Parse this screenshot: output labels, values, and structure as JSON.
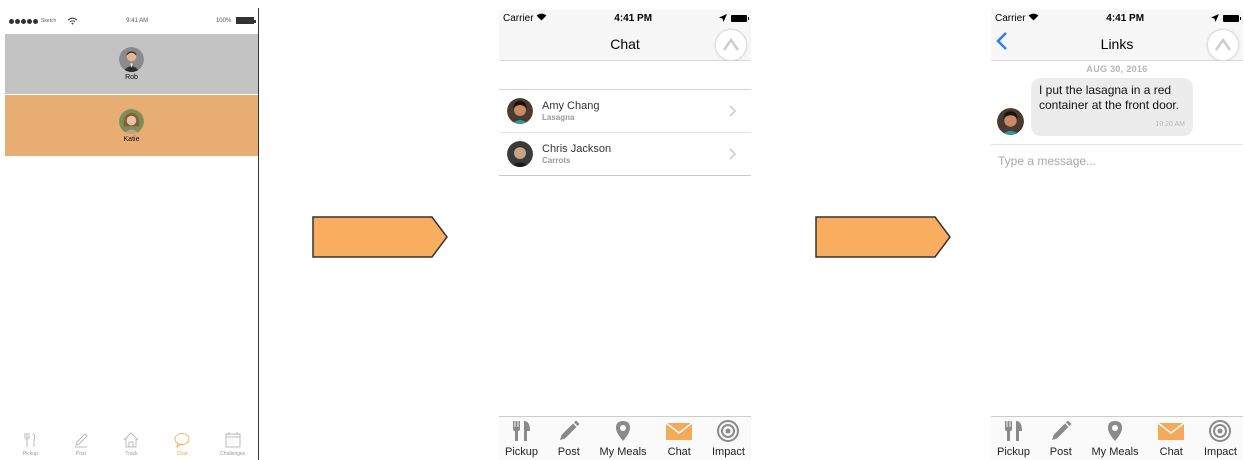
{
  "screen1": {
    "status": {
      "carrier": "Sketch",
      "time": "9:41 AM",
      "battery": "100%"
    },
    "rows": [
      {
        "name": "Rob",
        "bg": "#c3c3c3"
      },
      {
        "name": "Katie",
        "bg": "#e8ad72"
      }
    ],
    "tabs": [
      {
        "label": "Pickup",
        "icon": "fork-knife-icon"
      },
      {
        "label": "Post",
        "icon": "pencil-icon"
      },
      {
        "label": "Track",
        "icon": "house-icon"
      },
      {
        "label": "Chat",
        "icon": "speech-bubble-icon"
      },
      {
        "label": "Challenges",
        "icon": "calendar-icon"
      }
    ],
    "active_tab": "Chat"
  },
  "screen2": {
    "status": {
      "carrier": "Carrier",
      "time": "4:41 PM"
    },
    "title": "Chat",
    "conversations": [
      {
        "name": "Amy Chang",
        "subtitle": "Lasagna"
      },
      {
        "name": "Chris Jackson",
        "subtitle": "Carrots"
      }
    ],
    "tabs": [
      {
        "label": "Pickup",
        "icon": "fork-knife-icon"
      },
      {
        "label": "Post",
        "icon": "pencil-icon"
      },
      {
        "label": "My Meals",
        "icon": "map-pin-icon"
      },
      {
        "label": "Chat",
        "icon": "envelope-icon"
      },
      {
        "label": "Impact",
        "icon": "target-icon"
      }
    ],
    "active_tab": "Chat"
  },
  "screen3": {
    "status": {
      "carrier": "Carrier",
      "time": "4:41 PM"
    },
    "title": "Links",
    "date_header": "AUG 30, 2016",
    "message": {
      "text": "I put the lasagna in a red container at the front door.",
      "time": "10:20 AM"
    },
    "compose_placeholder": "Type a message...",
    "tabs": [
      {
        "label": "Pickup",
        "icon": "fork-knife-icon"
      },
      {
        "label": "Post",
        "icon": "pencil-icon"
      },
      {
        "label": "My Meals",
        "icon": "map-pin-icon"
      },
      {
        "label": "Chat",
        "icon": "envelope-icon"
      },
      {
        "label": "Impact",
        "icon": "target-icon"
      }
    ],
    "active_tab": "Chat"
  },
  "colors": {
    "accent": "#f5a95a",
    "arrow_fill": "#f8ad5f",
    "back_blue": "#2d7cf6"
  }
}
